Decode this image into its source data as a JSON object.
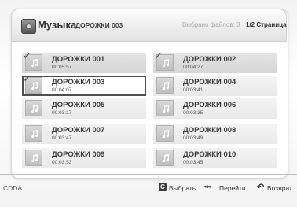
{
  "header": {
    "app_title": "Музыка",
    "folder_title": "ДОРОЖКИ 003",
    "selected_count": "Выбрано файлов: 3",
    "page_indicator": "1/2 Страница"
  },
  "tracks": [
    {
      "name": "ДОРОЖКИ 001",
      "duration": "00:05:57",
      "checked": true,
      "focused": false
    },
    {
      "name": "ДОРОЖКИ 002",
      "duration": "00:04:27",
      "checked": true,
      "focused": false
    },
    {
      "name": "ДОРОЖКИ 003",
      "duration": "00:04:07",
      "checked": true,
      "focused": true
    },
    {
      "name": "ДОРОЖКИ 004",
      "duration": "00:03:41",
      "checked": false,
      "focused": false
    },
    {
      "name": "ДОРОЖКИ 005",
      "duration": "00:03:17",
      "checked": false,
      "focused": false
    },
    {
      "name": "ДОРОЖКИ 006",
      "duration": "00:03:35",
      "checked": false,
      "focused": false
    },
    {
      "name": "ДОРОЖКИ 007",
      "duration": "00:03:47",
      "checked": false,
      "focused": false
    },
    {
      "name": "ДОРОЖКИ 008",
      "duration": "00:03:49",
      "checked": false,
      "focused": false
    },
    {
      "name": "ДОРОЖКИ 009",
      "duration": "00:03:53",
      "checked": false,
      "focused": false
    },
    {
      "name": "ДОРОЖКИ 010",
      "duration": "00:03:45",
      "checked": false,
      "focused": false
    }
  ],
  "footer": {
    "source_label": "CDDA",
    "select_key": "C",
    "select_label": "Выбрать",
    "navigate_label": "Перейти",
    "return_label": "Возврат"
  },
  "icons": {
    "app": "music-disc-icon",
    "track": "music-note-icon",
    "check": "checkmark-icon",
    "navigate": "left-right-arrows-icon",
    "return": "return-arrow-icon"
  }
}
